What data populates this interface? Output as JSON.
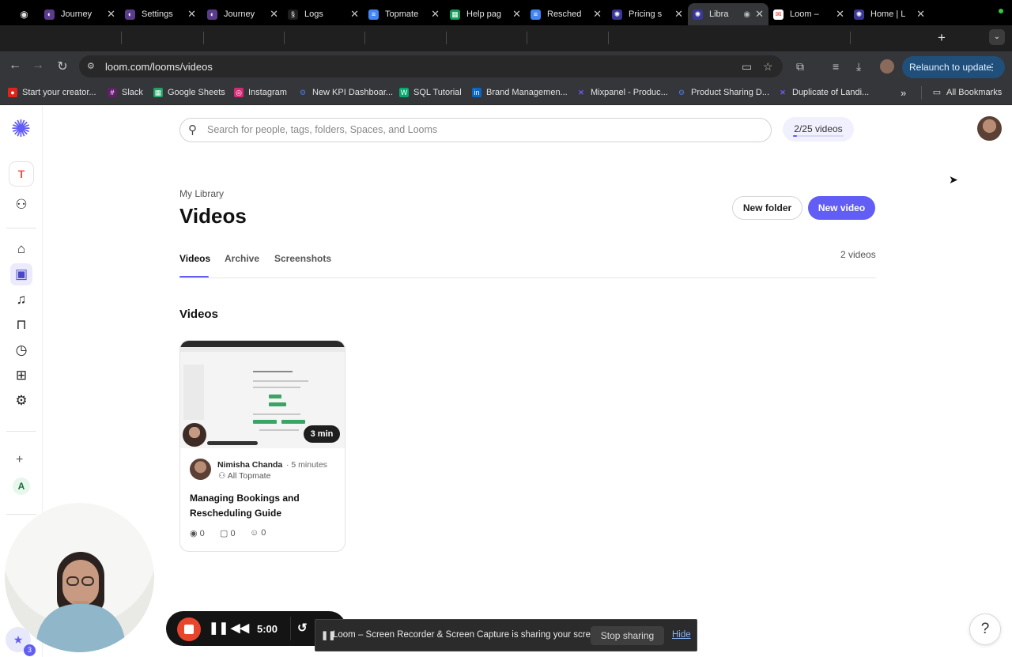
{
  "browser": {
    "tabs": [
      {
        "label": "",
        "icon": "record-icon"
      },
      {
        "label": "Journey",
        "icon": "loom-app-icon"
      },
      {
        "label": "Settings",
        "icon": "loom-app-icon"
      },
      {
        "label": "Journey",
        "icon": "loom-app-icon"
      },
      {
        "label": "Logs",
        "icon": "logs-icon"
      },
      {
        "label": "Topmate",
        "icon": "docs-icon"
      },
      {
        "label": "Help pag",
        "icon": "sheets-icon"
      },
      {
        "label": "Resched",
        "icon": "docs-icon"
      },
      {
        "label": "Pricing s",
        "icon": "loom-icon"
      },
      {
        "label": "Libra",
        "icon": "loom-icon"
      },
      {
        "label": "Loom –",
        "icon": "gmail-icon"
      },
      {
        "label": "Home | L",
        "icon": "loom-icon"
      }
    ],
    "new_tab_glyph": "+",
    "tab_menu_glyph": "⌄",
    "url": "loom.com/looms/videos",
    "relaunch_label": "Relaunch to update",
    "relaunch_more": "⋮",
    "bookmarks": [
      {
        "label": "Start your creator...",
        "color": "#e0241b",
        "glyph": "●"
      },
      {
        "label": "Slack",
        "color": "#611f69",
        "glyph": "#"
      },
      {
        "label": "Google Sheets",
        "color": "#1fa463",
        "glyph": "▦"
      },
      {
        "label": "Instagram",
        "color": "#d62976",
        "glyph": "◎"
      },
      {
        "label": "New KPI Dashboar...",
        "color": "#4b72b8",
        "glyph": "ʘ"
      },
      {
        "label": "SQL Tutorial",
        "color": "#04aa6d",
        "glyph": "W"
      },
      {
        "label": "Brand Managemen...",
        "color": "#0a66c2",
        "glyph": "in"
      },
      {
        "label": "Mixpanel - Produc...",
        "color": "#7856ff",
        "glyph": "✕"
      },
      {
        "label": "Product Sharing D...",
        "color": "#4b72b8",
        "glyph": "ʘ"
      },
      {
        "label": "Duplicate of Landi...",
        "color": "#7856ff",
        "glyph": "✕"
      }
    ],
    "bookmarks_more": "»",
    "all_bookmarks": "All Bookmarks"
  },
  "rail": {
    "workspace_initial": "T",
    "secondary_initial": "A",
    "plus": "+"
  },
  "header": {
    "search_placeholder": "Search for people, tags, folders, Spaces, and Looms",
    "quota_label": "2/25 videos",
    "quota_used": 2,
    "quota_total": 25
  },
  "page": {
    "breadcrumb": "My Library",
    "title": "Videos",
    "new_folder": "New folder",
    "new_video": "New video",
    "tabs": [
      "Videos",
      "Archive",
      "Screenshots"
    ],
    "count_label": "2 videos",
    "section_heading": "Videos"
  },
  "videos": [
    {
      "duration": "3 min",
      "author": "Nimisha Chanda",
      "ago": "· 5 minutes",
      "space": "All Topmate",
      "title": "Managing Bookings and Rescheduling Guide",
      "views": "0",
      "comments": "0",
      "reactions": "0"
    }
  ],
  "recorder": {
    "time": "5:00"
  },
  "share_banner": {
    "message": "Loom – Screen Recorder & Screen Capture is sharing your screen.",
    "stop_label": "Stop sharing",
    "hide_label": "Hide"
  },
  "help": {
    "glyph": "?",
    "badge": "3"
  },
  "colors": {
    "accent": "#625df5",
    "record": "#e8452e"
  }
}
